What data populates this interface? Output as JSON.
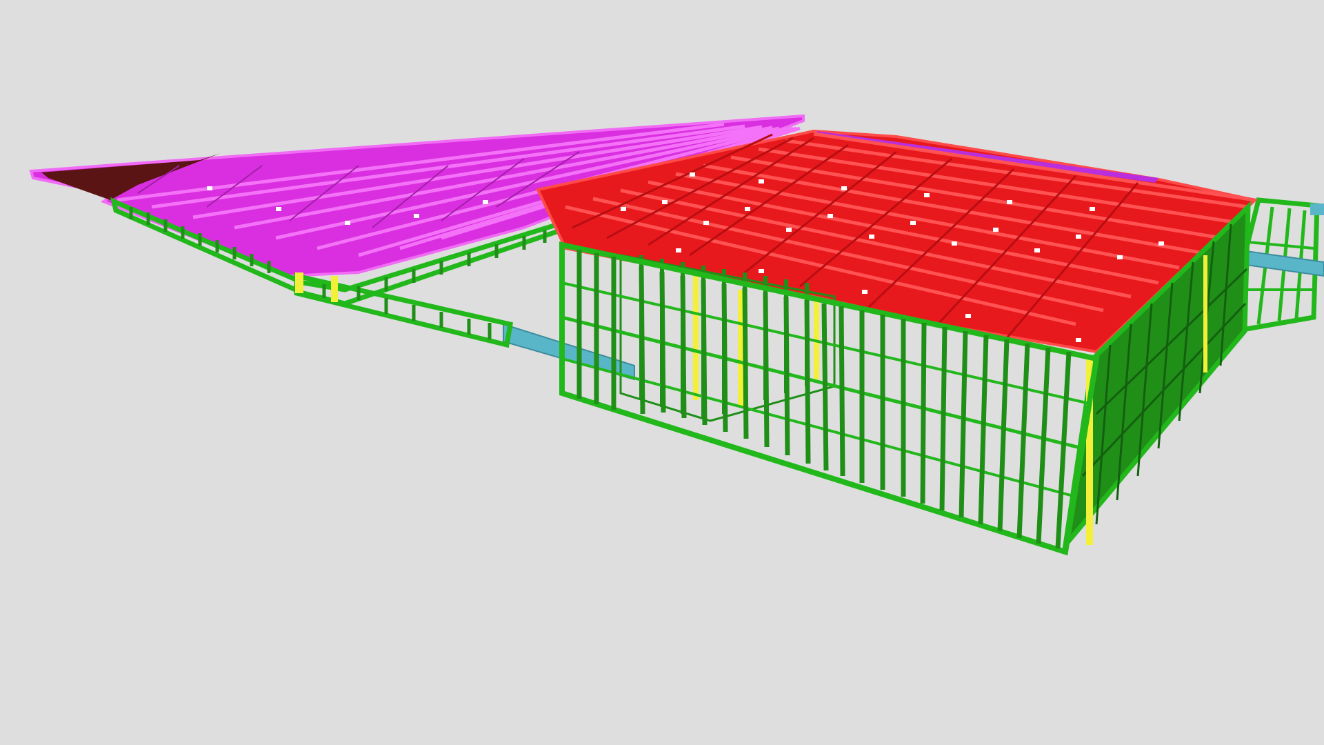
{
  "viewer": {
    "background": "#dedede"
  },
  "model": {
    "description_free": true,
    "layers": [
      {
        "id": "wall-frames",
        "icon": "wall-frame-icon",
        "color": "#22b81c",
        "highlight": "#6cf25a"
      },
      {
        "id": "interior-studs",
        "icon": "stud-icon",
        "color": "#1f8f18"
      },
      {
        "id": "roof-trusses-main",
        "icon": "truss-icon",
        "color": "#e8191d",
        "highlight": "#ff4a4a"
      },
      {
        "id": "roof-trusses-left",
        "icon": "truss-icon",
        "color": "#d92fe0",
        "highlight": "#f06cf5"
      },
      {
        "id": "roof-trusses-dark",
        "icon": "truss-icon",
        "color": "#5a1414"
      },
      {
        "id": "beams",
        "icon": "beam-icon",
        "color": "#59b6c8"
      },
      {
        "id": "posts",
        "icon": "post-icon",
        "color": "#f3f03a"
      },
      {
        "id": "connector-plates",
        "icon": "plate-icon",
        "color": "#ffffff"
      }
    ]
  }
}
